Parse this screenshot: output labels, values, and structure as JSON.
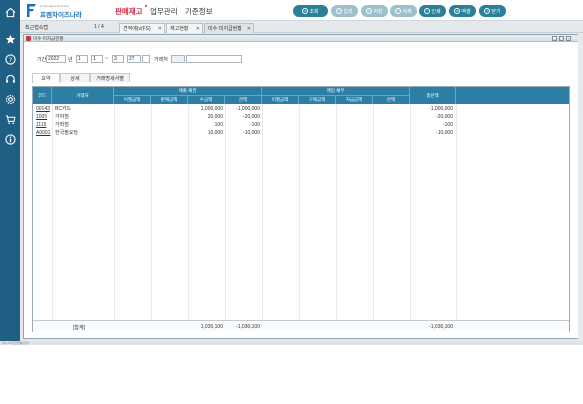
{
  "brand": {
    "logo_small": "Cooperative Business",
    "logo_text": "프렌차이즈나라",
    "accent": "#1c73b9",
    "rail_color": "#1f5f84",
    "button_color": "#2a7f99",
    "header_color": "#2c7ea4"
  },
  "rail_icons": [
    "home-icon",
    "star-icon",
    "help-icon",
    "headset-icon",
    "gear-icon",
    "cart-icon",
    "info-icon"
  ],
  "menu": {
    "items": [
      {
        "label": "판매재고",
        "active": true
      },
      {
        "label": "업무관리",
        "active": false
      },
      {
        "label": "기준정보",
        "active": false
      }
    ]
  },
  "toolbar": {
    "buttons": [
      {
        "label": "조회",
        "icon": "search-icon",
        "enabled": true
      },
      {
        "label": "입력",
        "icon": "add-icon",
        "enabled": false
      },
      {
        "label": "저장",
        "icon": "save-icon",
        "enabled": false
      },
      {
        "label": "삭제",
        "icon": "delete-icon",
        "enabled": false
      },
      {
        "label": "인쇄",
        "icon": "print-icon",
        "enabled": true
      },
      {
        "label": "엑셀",
        "icon": "excel-icon",
        "enabled": true
      },
      {
        "label": "닫기",
        "icon": "close-icon",
        "enabled": true
      }
    ]
  },
  "tabs": {
    "recent_label": "최근접속탭",
    "page": "1 / 4",
    "items": [
      "견적에(v(FS)",
      "재고현황",
      "미수·미지급현황"
    ],
    "active_index": 2
  },
  "window": {
    "title": "미수·미지급현황"
  },
  "filters": {
    "period_label": "기간",
    "year": "2022",
    "year_unit": "년",
    "month1": "1",
    "day1": "1",
    "sep": "~",
    "month2": "3",
    "day2": "27",
    "client_label": "거래처",
    "client_value": ""
  },
  "subtabs": {
    "items": [
      "요약",
      "상세",
      "거래명세서별"
    ],
    "active_index": 0
  },
  "grid": {
    "headers": {
      "code": "코드",
      "client": "거래처",
      "sales_group": "매출 채권",
      "purchase_group": "매입 채무",
      "total": "총잔액",
      "sales_cols": [
        "이월금액",
        "판매금액",
        "수금액",
        "잔액"
      ],
      "purchase_cols": [
        "이월금액",
        "구매금액",
        "지급금액",
        "잔액"
      ]
    },
    "rows": [
      {
        "code": "00143",
        "client": "BC카드",
        "s_carry": "",
        "s_sale": "",
        "s_collect": "1,000,000",
        "s_balance": "-1,000,000",
        "p_carry": "",
        "p_buy": "",
        "p_pay": "",
        "p_balance": "",
        "total": "-1,000,000"
      },
      {
        "code": "1005",
        "client": "가야점",
        "s_carry": "",
        "s_sale": "",
        "s_collect": "20,000",
        "s_balance": "-20,000",
        "p_carry": "",
        "p_buy": "",
        "p_pay": "",
        "p_balance": "",
        "total": "-20,000"
      },
      {
        "code": "1115",
        "client": "가좌점",
        "s_carry": "",
        "s_sale": "",
        "s_collect": "100",
        "s_balance": "-100",
        "p_carry": "",
        "p_buy": "",
        "p_pay": "",
        "p_balance": "",
        "total": "-100"
      },
      {
        "code": "A0001",
        "client": "한국필요당",
        "s_carry": "",
        "s_sale": "",
        "s_collect": "10,000",
        "s_balance": "-10,000",
        "p_carry": "",
        "p_buy": "",
        "p_pay": "",
        "p_balance": "",
        "total": "-10,000"
      }
    ],
    "footer": {
      "label": "[합계]",
      "s_collect": "1,030,100",
      "s_balance": "-1,030,100",
      "total": "-1,030,100"
    }
  },
  "status": {
    "text": "미수·미지급현황/관리"
  }
}
